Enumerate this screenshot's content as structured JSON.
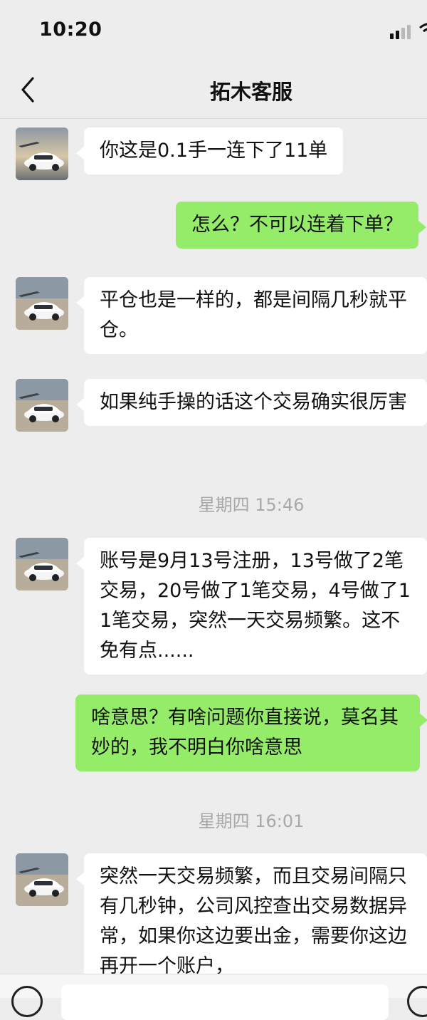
{
  "status_bar": {
    "time": "10:20"
  },
  "header": {
    "title": "拓木客服",
    "back_icon": "chevron-left-icon"
  },
  "messages": [
    {
      "side": "in",
      "text": "你这是0.1手一连下了11单"
    },
    {
      "side": "out",
      "text": "怎么？不可以连着下单？"
    },
    {
      "side": "in",
      "text": "平仓也是一样的，都是间隔几秒就平仓。"
    },
    {
      "side": "in",
      "text": "如果纯手操的话这个交易确实很厉害"
    },
    {
      "side": "time",
      "text": "星期四 15:46"
    },
    {
      "side": "in",
      "text": "账号是9月13号注册，13号做了2笔交易，20号做了1笔交易，4号做了11笔交易，突然一天交易频繁。这不免有点......"
    },
    {
      "side": "out",
      "text": "啥意思？有啥问题你直接说，莫名其妙的，我不明白你啥意思"
    },
    {
      "side": "time",
      "text": "星期四 16:01"
    },
    {
      "side": "in",
      "text": "突然一天交易频繁，而且交易间隔只有几秒钟，公司风控查出交易数据异常，如果你这边要出金，需要你这边再开一个账户，"
    }
  ],
  "colors": {
    "background": "#ededed",
    "bubble_in": "#ffffff",
    "bubble_out": "#95ec69",
    "timestamp": "#a8a8a8"
  },
  "icons": {
    "avatar": "car-avatar",
    "voice": "voice-icon",
    "plus": "plus-icon"
  }
}
